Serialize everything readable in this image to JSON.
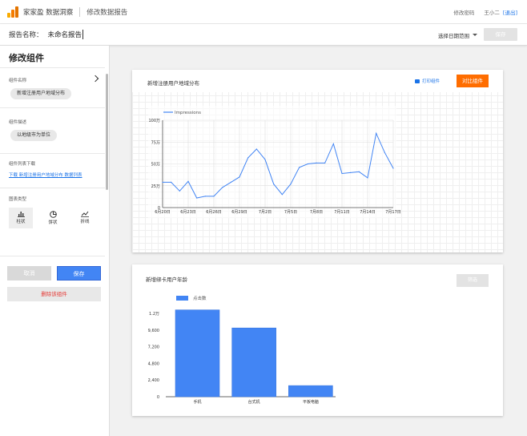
{
  "header": {
    "brand": "家家盈 数据洞察",
    "title": "修改数据报告",
    "change_password": "修改密码",
    "user": "王小二",
    "logout": "[退出]"
  },
  "report": {
    "name_label": "报告名称：",
    "name_value": "未命名报告",
    "date_range": "选择日期范围",
    "save": "保存"
  },
  "sidebar": {
    "title": "修改组件",
    "widget_name_label": "组件名称",
    "widget_name_value": "新增注册用户地域分布",
    "widget_desc_label": "组件描述",
    "widget_desc_value": "以地级市为单位",
    "download_label": "组件列表下载",
    "download_link": "下载 新增注册用户地域分布 数据列表",
    "chart_type_label": "图表类型",
    "chart_types": [
      "柱状",
      "饼状",
      "折线"
    ],
    "cancel": "取消",
    "save": "保存",
    "delete": "删除该组件"
  },
  "card1": {
    "title": "新增注册用户地域分布",
    "print": "打印组件",
    "compare": "对比组件"
  },
  "card2": {
    "title": "新增绑卡用户年龄",
    "filter": "筛选"
  },
  "colors": {
    "accent": "#4285f4",
    "orange": "#ff6d00",
    "link": "#1a73e8"
  },
  "chart_data": [
    {
      "type": "line",
      "legend": "Impressions",
      "x_ticks": [
        "6月20日",
        "6月23日",
        "6月26日",
        "6月29日",
        "7月2日",
        "7月5日",
        "7月8日",
        "7月11日",
        "7月14日",
        "7月17日"
      ],
      "y_ticks": [
        "0",
        "25万",
        "50万",
        "75万",
        "100万"
      ],
      "ylim": [
        0,
        100
      ],
      "values": [
        29,
        29,
        19,
        30,
        11,
        13,
        13,
        23,
        29,
        35,
        57,
        67,
        55,
        27,
        15,
        27,
        46,
        50,
        51,
        51,
        73,
        39,
        40,
        41,
        34,
        85,
        63,
        45
      ],
      "grid": true
    },
    {
      "type": "bar",
      "legend": "点击数",
      "categories": [
        "手机",
        "台式机",
        "平板电脑"
      ],
      "values": [
        12500,
        9900,
        1600
      ],
      "y_ticks": [
        "0",
        "2,400",
        "4,800",
        "7,200",
        "9,600",
        "1.2万"
      ],
      "ylim": [
        0,
        12000
      ],
      "grid": false
    }
  ]
}
